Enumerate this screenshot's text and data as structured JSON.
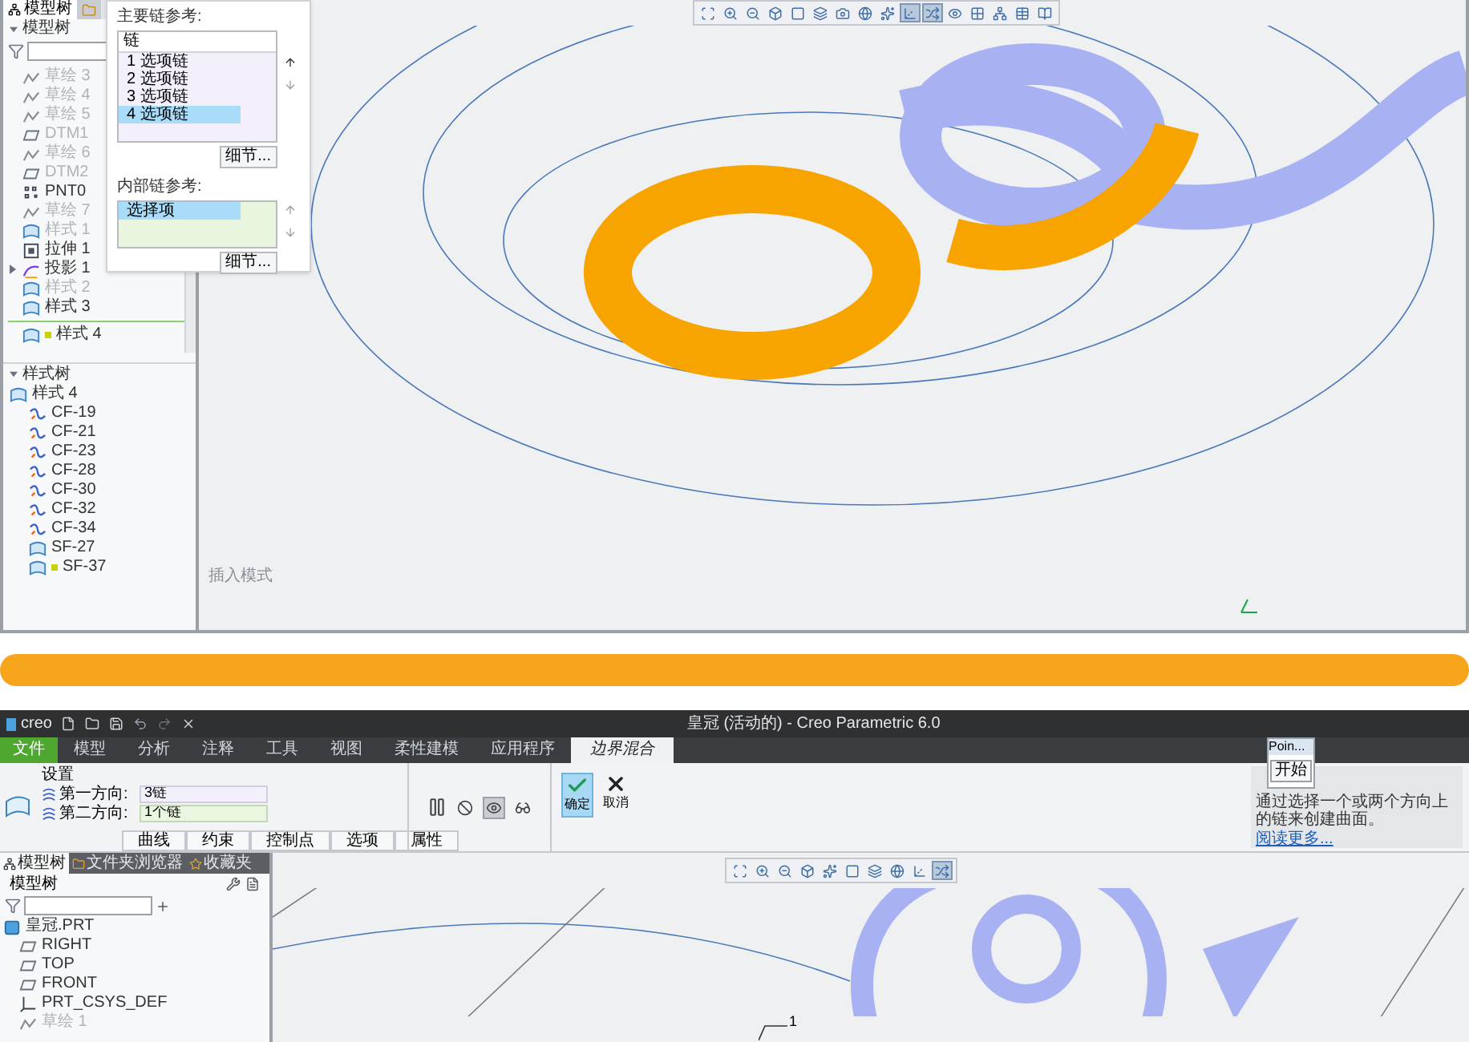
{
  "top_view": {
    "tree_tabs": [
      {
        "label": "模型树",
        "kind": "tree",
        "selected": true
      },
      {
        "kind": "folder",
        "selected": false
      }
    ],
    "tree_title": "模型树",
    "tree_items": [
      {
        "label": "草绘 3",
        "kind": "sketch",
        "dimmed": true
      },
      {
        "label": "草绘 4",
        "kind": "sketch",
        "dimmed": true
      },
      {
        "label": "草绘 5",
        "kind": "sketch",
        "dimmed": true
      },
      {
        "label": "DTM1",
        "kind": "plane",
        "dimmed": true
      },
      {
        "label": "草绘 6",
        "kind": "sketch",
        "dimmed": true
      },
      {
        "label": "DTM2",
        "kind": "plane",
        "dimmed": true
      },
      {
        "label": "PNT0",
        "kind": "point",
        "dimmed": false
      },
      {
        "label": "草绘 7",
        "kind": "sketch",
        "dimmed": true
      },
      {
        "label": "样式 1",
        "kind": "style",
        "dimmed": true
      },
      {
        "label": "拉伸 1",
        "kind": "extrude",
        "dimmed": false
      },
      {
        "label": "投影 1",
        "kind": "projection",
        "dimmed": false,
        "expanded": false
      },
      {
        "label": "样式 2",
        "kind": "style",
        "dimmed": true
      },
      {
        "label": "样式 3",
        "kind": "style",
        "dimmed": false
      }
    ],
    "insert_item": {
      "label": "样式 4",
      "kind": "style",
      "flagged": true
    },
    "style_tree": {
      "title": "样式树",
      "expanded": true,
      "items": [
        {
          "label": "样式 4",
          "kind": "style",
          "flagged": false,
          "children": [
            {
              "label": "CF-19",
              "kind": "curve",
              "flagged": false
            },
            {
              "label": "CF-21",
              "kind": "curve",
              "flagged": false
            },
            {
              "label": "CF-23",
              "kind": "curve",
              "flagged": false
            },
            {
              "label": "CF-28",
              "kind": "curve",
              "flagged": false
            },
            {
              "label": "CF-30",
              "kind": "curve",
              "flagged": false
            },
            {
              "label": "CF-32",
              "kind": "curve",
              "flagged": false
            },
            {
              "label": "CF-34",
              "kind": "curve",
              "flagged": false
            },
            {
              "label": "SF-27",
              "kind": "surface",
              "flagged": false
            },
            {
              "label": "SF-37",
              "kind": "surface",
              "flagged": true
            }
          ]
        }
      ]
    },
    "dialog": {
      "primary_title": "主要链参考:",
      "column": "链",
      "chains": [
        {
          "label": "1 选项链",
          "selected": false
        },
        {
          "label": "2 选项链",
          "selected": false
        },
        {
          "label": "3 选项链",
          "selected": false
        },
        {
          "label": "4 选项链",
          "selected": true
        }
      ],
      "details_button": "细节...",
      "inner_title": "内部链参考:",
      "inner_items": [
        {
          "label": "选择项",
          "selected": true
        }
      ],
      "inner_details_button": "细节..."
    },
    "toolbar": [
      {
        "kind": "refit",
        "pressed": false
      },
      {
        "kind": "zoom-in",
        "pressed": false
      },
      {
        "kind": "zoom-out",
        "pressed": false
      },
      {
        "kind": "cube",
        "pressed": false
      },
      {
        "kind": "square",
        "pressed": false
      },
      {
        "kind": "layers",
        "pressed": false
      },
      {
        "kind": "camera",
        "pressed": false
      },
      {
        "kind": "globe",
        "pressed": false
      },
      {
        "kind": "sparkle",
        "pressed": false
      },
      {
        "kind": "axis",
        "pressed": true
      },
      {
        "kind": "shuffle",
        "pressed": true
      },
      {
        "kind": "eye",
        "pressed": false
      },
      {
        "kind": "grid",
        "pressed": false
      },
      {
        "kind": "network",
        "pressed": false
      },
      {
        "kind": "table",
        "pressed": false
      },
      {
        "kind": "book",
        "pressed": false
      }
    ],
    "mode_text": "插入模式"
  },
  "bottom_view": {
    "app_logo": "creo",
    "window_title": "皇冠 (活动的) - Creo Parametric 6.0",
    "ribbon_tabs": [
      {
        "label": "文件",
        "kind": "file",
        "selected": false
      },
      {
        "label": "模型",
        "kind": "tab",
        "selected": false
      },
      {
        "label": "分析",
        "kind": "tab",
        "selected": false
      },
      {
        "label": "注释",
        "kind": "tab",
        "selected": false
      },
      {
        "label": "工具",
        "kind": "tab",
        "selected": false
      },
      {
        "label": "视图",
        "kind": "tab",
        "selected": false
      },
      {
        "label": "柔性建模",
        "kind": "tab",
        "selected": false
      },
      {
        "label": "应用程序",
        "kind": "tab",
        "selected": false
      },
      {
        "label": "边界混合",
        "kind": "tab",
        "selected": true
      }
    ],
    "settings": {
      "title": "设置",
      "fields": [
        {
          "label": "第一方向:",
          "value": "3链",
          "active": false
        },
        {
          "label": "第二方向:",
          "value": "1个链",
          "active": true
        }
      ]
    },
    "sub_tabs": [
      "曲线",
      "约束",
      "控制点",
      "选项",
      "属性"
    ],
    "preview_tools": [
      {
        "kind": "pause",
        "pressed": false
      },
      {
        "kind": "stop",
        "pressed": false
      },
      {
        "kind": "preview",
        "pressed": true
      },
      {
        "kind": "glasses",
        "pressed": false
      }
    ],
    "confirm": {
      "label": "确定",
      "selected": true
    },
    "cancel": {
      "label": "取消"
    },
    "help": {
      "text": "通过选择一个或两个方向上的链来创建曲面。",
      "link": "阅读更多..."
    },
    "popup": {
      "title": "Poin...",
      "button": "开始"
    },
    "tree_tabs": [
      {
        "label": "模型树",
        "kind": "tree",
        "selected": true
      },
      {
        "label": "文件夹浏览器",
        "kind": "folder",
        "selected": false
      },
      {
        "label": "收藏夹",
        "kind": "star",
        "selected": false
      }
    ],
    "tree_title": "模型树",
    "tree": [
      {
        "label": "皇冠.PRT",
        "kind": "part",
        "dimmed": false,
        "children": [
          {
            "label": "RIGHT",
            "kind": "plane",
            "dimmed": false
          },
          {
            "label": "TOP",
            "kind": "plane",
            "dimmed": false
          },
          {
            "label": "FRONT",
            "kind": "plane",
            "dimmed": false
          },
          {
            "label": "PRT_CSYS_DEF",
            "kind": "csys",
            "dimmed": false
          },
          {
            "label": "草绘 1",
            "kind": "sketch",
            "dimmed": true
          }
        ]
      }
    ],
    "toolbar": [
      {
        "kind": "refit",
        "pressed": false
      },
      {
        "kind": "zoom-in",
        "pressed": false
      },
      {
        "kind": "zoom-out",
        "pressed": false
      },
      {
        "kind": "cube",
        "pressed": false
      },
      {
        "kind": "sparkle",
        "pressed": false
      },
      {
        "kind": "square",
        "pressed": false
      },
      {
        "kind": "layers",
        "pressed": false
      },
      {
        "kind": "globe",
        "pressed": false
      },
      {
        "kind": "axis",
        "pressed": false
      },
      {
        "kind": "shuffle",
        "pressed": true
      }
    ],
    "callout": "1"
  }
}
